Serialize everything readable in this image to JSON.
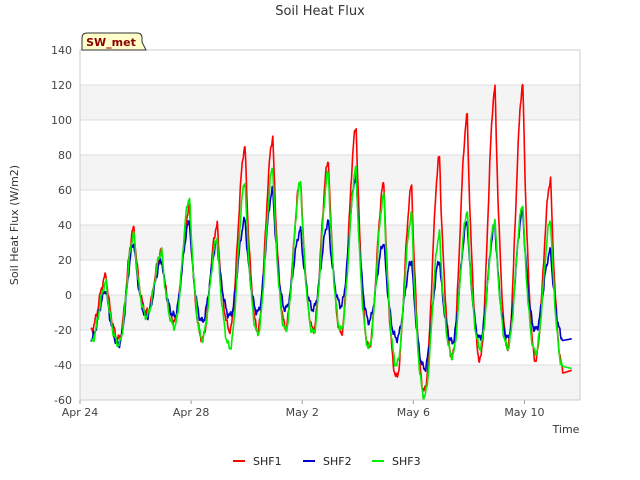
{
  "chart_data": {
    "type": "line",
    "title": "Soil Heat Flux",
    "xlabel": "Time",
    "ylabel": "Soil Heat Flux (W/m2)",
    "badge": "SW_met",
    "xlim": [
      0,
      18
    ],
    "ylim": [
      -60,
      140
    ],
    "yticks": [
      -60,
      -40,
      -20,
      0,
      20,
      40,
      60,
      80,
      100,
      120,
      140
    ],
    "xticks": [
      {
        "value": 0,
        "label": "Apr 24"
      },
      {
        "value": 4,
        "label": "Apr 28"
      },
      {
        "value": 8,
        "label": "May 2"
      },
      {
        "value": 12,
        "label": "May 6"
      },
      {
        "value": 16,
        "label": "May 10"
      }
    ],
    "grid": true,
    "legend_position": "bottom-center",
    "series": [
      {
        "name": "SHF1",
        "color": "#ff0000",
        "day_start": 0.4,
        "peaks": [
          11,
          38,
          25,
          50,
          40,
          85,
          90,
          66,
          77,
          96,
          64,
          62,
          79,
          102,
          118,
          120,
          66
        ],
        "troughs": [
          -20,
          -25,
          -10,
          -15,
          -25,
          -20,
          -20,
          -18,
          -20,
          -22,
          -30,
          -47,
          -55,
          -35,
          -37,
          -30,
          -37,
          -43
        ]
      },
      {
        "name": "SHF2",
        "color": "#0000cc",
        "day_start": 0.4,
        "peaks": [
          3,
          30,
          20,
          42,
          30,
          43,
          60,
          37,
          42,
          68,
          30,
          20,
          20,
          42,
          40,
          48,
          25
        ],
        "troughs": [
          -25,
          -28,
          -12,
          -12,
          -15,
          -12,
          -10,
          -8,
          -8,
          -6,
          -15,
          -25,
          -42,
          -27,
          -25,
          -25,
          -20,
          -25
        ]
      },
      {
        "name": "SHF3",
        "color": "#00ee00",
        "day_start": 0.4,
        "peaks": [
          7,
          35,
          25,
          56,
          33,
          65,
          73,
          65,
          70,
          72,
          57,
          46,
          35,
          48,
          43,
          52,
          43
        ],
        "troughs": [
          -27,
          -28,
          -12,
          -18,
          -25,
          -30,
          -22,
          -20,
          -22,
          -20,
          -30,
          -40,
          -58,
          -35,
          -30,
          -30,
          -33,
          -42
        ]
      }
    ]
  }
}
